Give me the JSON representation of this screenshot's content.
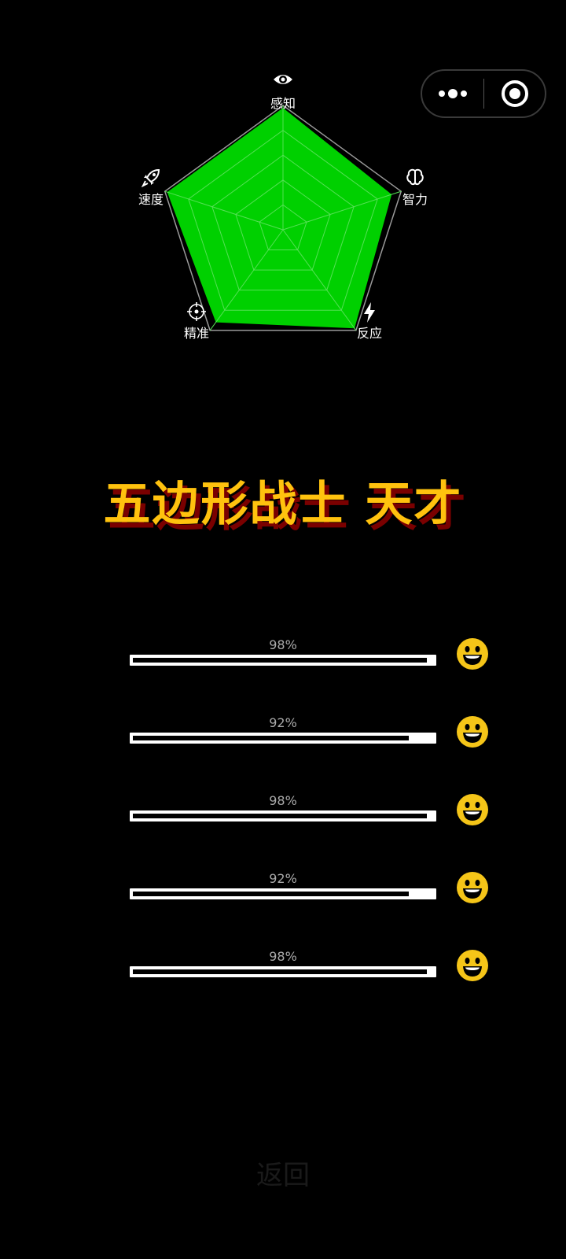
{
  "capsule": {
    "more_icon": "more-dots-icon",
    "close_icon": "target-circle-icon"
  },
  "chart_data": {
    "type": "radar",
    "axes": [
      "感知",
      "智力",
      "反应",
      "精准",
      "速度"
    ],
    "axis_icons": [
      "eye-icon",
      "brain-icon",
      "lightning-icon",
      "crosshair-icon",
      "rocket-icon"
    ],
    "values": [
      98,
      92,
      98,
      92,
      98
    ],
    "max": 100,
    "levels": 5,
    "fill_color": "#00d000"
  },
  "result": {
    "title": "五边形战士 天才"
  },
  "scores": [
    {
      "percent_text": "98%",
      "value": 0.98
    },
    {
      "percent_text": "92%",
      "value": 0.92
    },
    {
      "percent_text": "98%",
      "value": 0.98
    },
    {
      "percent_text": "92%",
      "value": 0.92
    },
    {
      "percent_text": "98%",
      "value": 0.98
    }
  ],
  "smiley_color": "#f5c518",
  "footer": {
    "back_label": "返回"
  }
}
